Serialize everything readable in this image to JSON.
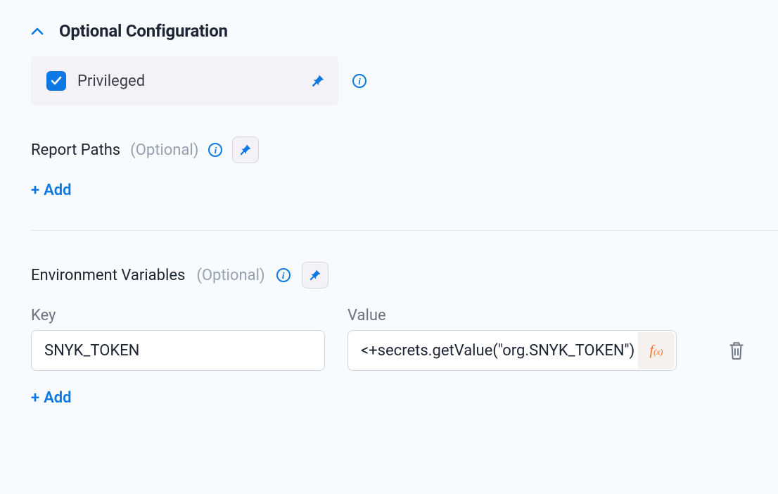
{
  "section": {
    "title": "Optional Configuration"
  },
  "privileged": {
    "label": "Privileged",
    "checked": true
  },
  "reportPaths": {
    "label": "Report Paths",
    "optional": "(Optional)",
    "addLabel": "Add"
  },
  "envVars": {
    "label": "Environment Variables",
    "optional": "(Optional)",
    "keyHeader": "Key",
    "valueHeader": "Value",
    "rows": [
      {
        "key": "SNYK_TOKEN",
        "value": "<+secrets.getValue(\"org.SNYK_TOKEN\")>"
      }
    ],
    "addLabel": "Add"
  },
  "icons": {
    "info": "i",
    "fx": "f",
    "fxSub": "(x)"
  }
}
